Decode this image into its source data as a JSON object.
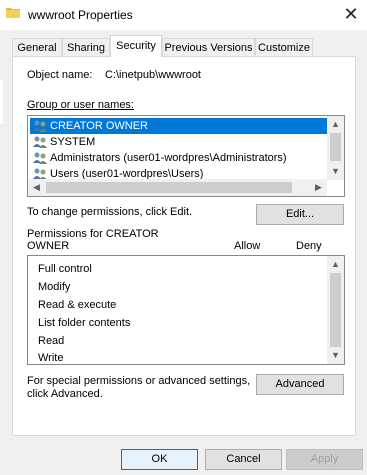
{
  "window": {
    "title": "wwwroot Properties",
    "close_glyph": "✕"
  },
  "tabs": [
    {
      "label": "General"
    },
    {
      "label": "Sharing"
    },
    {
      "label": "Security",
      "active": true
    },
    {
      "label": "Previous Versions"
    },
    {
      "label": "Customize"
    }
  ],
  "object": {
    "label": "Object name:",
    "value": "C:\\inetpub\\wwwroot"
  },
  "groups": {
    "label": "Group or user names:",
    "items": [
      {
        "label": "CREATOR OWNER",
        "icon": "users-icon",
        "selected": true
      },
      {
        "label": "SYSTEM",
        "icon": "users-icon"
      },
      {
        "label": "Administrators (user01-wordpres\\Administrators)",
        "icon": "users-icon"
      },
      {
        "label": "Users (user01-wordpres\\Users)",
        "icon": "users-icon"
      }
    ]
  },
  "change_hint": "To change permissions, click Edit.",
  "edit_button": "Edit...",
  "permissions": {
    "header_line1": "Permissions for CREATOR",
    "header_line2": "OWNER",
    "allow_label": "Allow",
    "deny_label": "Deny",
    "items": [
      {
        "label": "Full control"
      },
      {
        "label": "Modify"
      },
      {
        "label": "Read & execute"
      },
      {
        "label": "List folder contents"
      },
      {
        "label": "Read"
      },
      {
        "label": "Write"
      }
    ]
  },
  "advanced_hint_line1": "For special permissions or advanced settings,",
  "advanced_hint_line2": "click Advanced.",
  "advanced_button": "Advanced",
  "footer": {
    "ok": "OK",
    "cancel": "Cancel",
    "apply": "Apply"
  },
  "colors": {
    "selection": "#0078d7",
    "focus_border": "#0078d7"
  }
}
